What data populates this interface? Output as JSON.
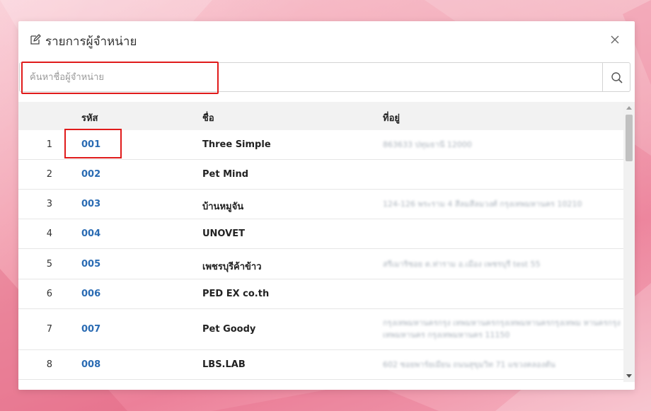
{
  "modal": {
    "title": "รายการผู้จำหน่าย",
    "title_icon": "edit-icon",
    "close_icon": "close-icon"
  },
  "search": {
    "placeholder": "ค้นหาชื่อผู้จำหน่าย",
    "value": "",
    "icon": "search-icon"
  },
  "table": {
    "headers": {
      "code": "รหัส",
      "name": "ชื่อ",
      "address": "ที่อยู่"
    },
    "rows": [
      {
        "no": "1",
        "code": "001",
        "name": "Three Simple",
        "address": "863633 ปทุมธานี 12000"
      },
      {
        "no": "2",
        "code": "002",
        "name": "Pet Mind",
        "address": ""
      },
      {
        "no": "3",
        "code": "003",
        "name": "บ้านหมูจัน",
        "address": "124-126 พระราม 4 สีลมสีลมวงศ์ กรุงเทพมหานคร 10210"
      },
      {
        "no": "4",
        "code": "004",
        "name": "UNOVET",
        "address": ""
      },
      {
        "no": "5",
        "code": "005",
        "name": "เพชรบุรีค้าข้าว",
        "address": "สรีเมาริซอย ต.ท่าราม อ.เมือง เพชรบุรี test 55"
      },
      {
        "no": "6",
        "code": "006",
        "name": "PED EX co.th",
        "address": ""
      },
      {
        "no": "7",
        "code": "007",
        "name": "Pet Goody",
        "address": "กรุงเทพมหานครกรุง เทพมหานครกรุงเทพมหานครกรุงเทพม หานครกรุง เทพมหานคร กรุงเทพมหานคร 11150"
      },
      {
        "no": "8",
        "code": "008",
        "name": "LBS.LAB",
        "address": "602 ซอยพาร์ยเมียน ถนนสุขุมวิท 71 แขวงคลองตัน"
      }
    ]
  },
  "colors": {
    "link": "#2a6bb3",
    "highlight": "#e01b1b",
    "header_bg": "#f2f2f2",
    "background_pink": "#f19aab"
  }
}
